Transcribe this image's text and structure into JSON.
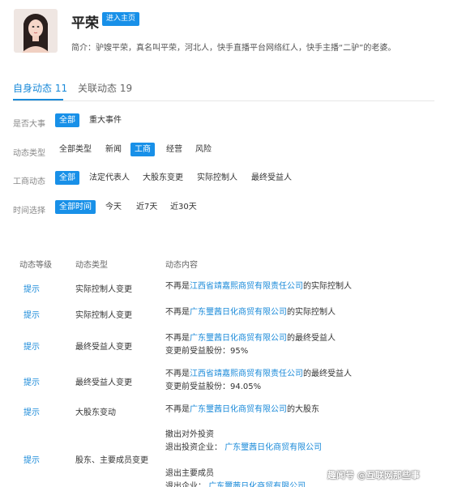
{
  "profile": {
    "name": "平荣",
    "home_button": "进入主页",
    "intro": "简介：驴嫂平荣，真名叫平荣，河北人，快手直播平台网络红人，快手主播“二驴”的老婆。"
  },
  "tabs": [
    {
      "label": "自身动态 11",
      "active": true
    },
    {
      "label": "关联动态 19",
      "active": false
    }
  ],
  "filters": [
    {
      "label": "是否大事",
      "options": [
        {
          "text": "全部",
          "selected": true
        },
        {
          "text": "重大事件",
          "selected": false
        }
      ]
    },
    {
      "label": "动态类型",
      "options": [
        {
          "text": "全部类型",
          "selected": false
        },
        {
          "text": "新闻",
          "selected": false
        },
        {
          "text": "工商",
          "selected": true
        },
        {
          "text": "经营",
          "selected": false
        },
        {
          "text": "风险",
          "selected": false
        }
      ]
    },
    {
      "label": "工商动态",
      "options": [
        {
          "text": "全部",
          "selected": true
        },
        {
          "text": "法定代表人",
          "selected": false
        },
        {
          "text": "大股东变更",
          "selected": false
        },
        {
          "text": "实际控制人",
          "selected": false
        },
        {
          "text": "最终受益人",
          "selected": false
        }
      ]
    },
    {
      "label": "时间选择",
      "options": [
        {
          "text": "全部时间",
          "selected": true
        },
        {
          "text": "今天",
          "selected": false
        },
        {
          "text": "近7天",
          "selected": false
        },
        {
          "text": "近30天",
          "selected": false
        }
      ]
    }
  ],
  "table": {
    "headers": [
      "动态等级",
      "动态类型",
      "动态内容"
    ],
    "rows": [
      {
        "level": "提示",
        "type": "实际控制人变更",
        "lines": [
          [
            {
              "t": "不再是"
            },
            {
              "t": "江西省靖嘉熙商贸有限责任公司",
              "link": true
            },
            {
              "t": "的实际控制人"
            }
          ]
        ]
      },
      {
        "level": "提示",
        "type": "实际控制人变更",
        "lines": [
          [
            {
              "t": "不再是"
            },
            {
              "t": "广东璽茜日化商贸有限公司",
              "link": true
            },
            {
              "t": "的实际控制人"
            }
          ]
        ]
      },
      {
        "level": "提示",
        "type": "最终受益人变更",
        "lines": [
          [
            {
              "t": "不再是"
            },
            {
              "t": "广东璽茜日化商贸有限公司",
              "link": true
            },
            {
              "t": "的最终受益人"
            }
          ],
          [
            {
              "t": "变更前受益股份：95%"
            }
          ]
        ]
      },
      {
        "level": "提示",
        "type": "最终受益人变更",
        "lines": [
          [
            {
              "t": "不再是"
            },
            {
              "t": "江西省靖嘉熙商贸有限责任公司",
              "link": true
            },
            {
              "t": "的最终受益人"
            }
          ],
          [
            {
              "t": "变更前受益股份：94.05%"
            }
          ]
        ]
      },
      {
        "level": "提示",
        "type": "大股东变动",
        "lines": [
          [
            {
              "t": "不再是"
            },
            {
              "t": "广东璽茜日化商贸有限公司",
              "link": true
            },
            {
              "t": "的大股东"
            }
          ]
        ]
      },
      {
        "level": "提示",
        "type": "股东、主要成员变更",
        "lines": [
          [
            {
              "t": "撤出对外投资"
            }
          ],
          [
            {
              "t": "退出投资企业：  "
            },
            {
              "t": "广东璽茜日化商贸有限公司",
              "link": true
            }
          ],
          [
            {
              "t": ""
            }
          ],
          [
            {
              "t": "退出主要成员"
            }
          ],
          [
            {
              "t": "退出企业：  "
            },
            {
              "t": "广东璽茜日化商贸有限公司",
              "link": true
            }
          ]
        ]
      }
    ]
  },
  "watermark": "趣闻号  @互联网那些事"
}
